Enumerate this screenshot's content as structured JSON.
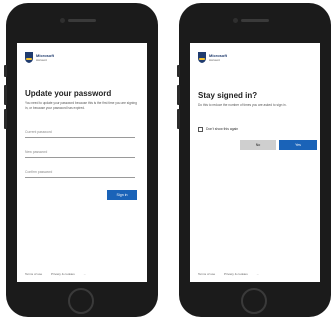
{
  "brand": {
    "name": "Microsoft",
    "sub": "Account"
  },
  "left_screen": {
    "title": "Update your password",
    "description": "You need to update your password because this is the first time you are signing in, or because your password has expired.",
    "fields": [
      {
        "placeholder": "Current password"
      },
      {
        "placeholder": "New password"
      },
      {
        "placeholder": "Confirm password"
      }
    ],
    "submit_label": "Sign in",
    "footer": [
      "Terms of use",
      "Privacy & cookies",
      "..."
    ]
  },
  "right_screen": {
    "title": "Stay signed in?",
    "description": "Do this to reduce the number of times you are asked to sign in.",
    "checkbox_label": "Don't show this again",
    "no_label": "No",
    "yes_label": "Yes",
    "footer": [
      "Terms of use",
      "Privacy & cookies",
      "..."
    ]
  },
  "colors": {
    "accent": "#1a63b8",
    "phone": "#1b1b1b"
  }
}
